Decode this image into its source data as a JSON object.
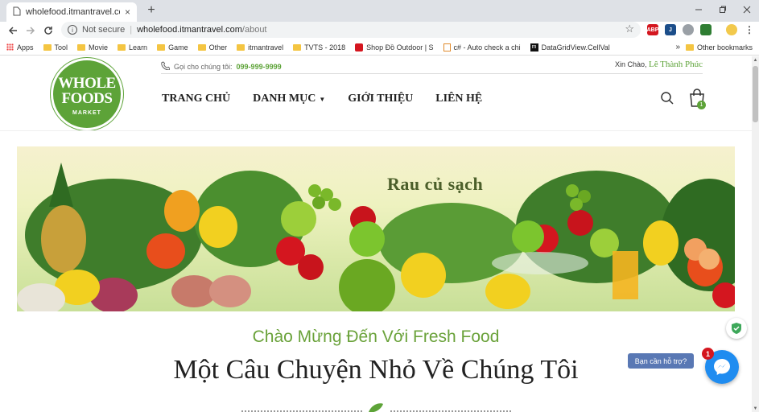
{
  "browser": {
    "tab_title": "wholefood.itmantravel.com/abou",
    "new_tab": "+",
    "tab_close": "×",
    "url_not_secure": "Not secure",
    "url_host": "wholefood.itmantravel.com",
    "url_path": "/about",
    "bookmarks": [
      {
        "label": "Apps",
        "icon": "apps-grid-icon"
      },
      {
        "label": "Tool",
        "icon": "folder-icon"
      },
      {
        "label": "Movie",
        "icon": "folder-icon"
      },
      {
        "label": "Learn",
        "icon": "folder-icon"
      },
      {
        "label": "Game",
        "icon": "folder-icon"
      },
      {
        "label": "Other",
        "icon": "folder-icon"
      },
      {
        "label": "itmantravel",
        "icon": "folder-icon"
      },
      {
        "label": "TVTS - 2018",
        "icon": "folder-icon"
      },
      {
        "label": "Shop Đồ Outdoor | S",
        "icon": "shop-icon"
      },
      {
        "label": "c# - Auto check a chi",
        "icon": "page-icon"
      },
      {
        "label": "DataGridView.CellVal",
        "icon": "m-icon"
      }
    ],
    "bookmarks_more": "»",
    "other_bookmarks": "Other bookmarks",
    "extensions": [
      {
        "label": "ABP",
        "color": "#d4161f"
      },
      {
        "label": "J",
        "color": "#1c4e8a"
      },
      {
        "label": "",
        "color": "#9aa0a6"
      },
      {
        "label": "",
        "color": "#2e7d32"
      }
    ]
  },
  "site": {
    "logo": {
      "line1": "WHOLE",
      "line2": "FOODS",
      "line3": "MARKET"
    },
    "phone_label": "Gọi cho chúng tôi:",
    "phone_number": "099-999-9999",
    "greeting_prefix": "Xin Chào,",
    "greeting_name": "Lê Thành Phúc",
    "nav": [
      {
        "label": "TRANG CHỦ"
      },
      {
        "label": "DANH MỤC"
      },
      {
        "label": "GIỚI THIỆU"
      },
      {
        "label": "LIÊN HỆ"
      }
    ],
    "cart_count": "1",
    "banner_title": "Rau củ sạch",
    "welcome": "Chào Mừng Đến Với Fresh Food",
    "headline": "Một Câu Chuyện Nhỏ Về Chúng Tôi"
  },
  "widgets": {
    "help_label": "Bạn cần hỗ trợ?",
    "messenger_badge": "1"
  },
  "colors": {
    "brand_green": "#5da338",
    "messenger_blue": "#1f8cf0",
    "help_blue": "#5978b4"
  }
}
